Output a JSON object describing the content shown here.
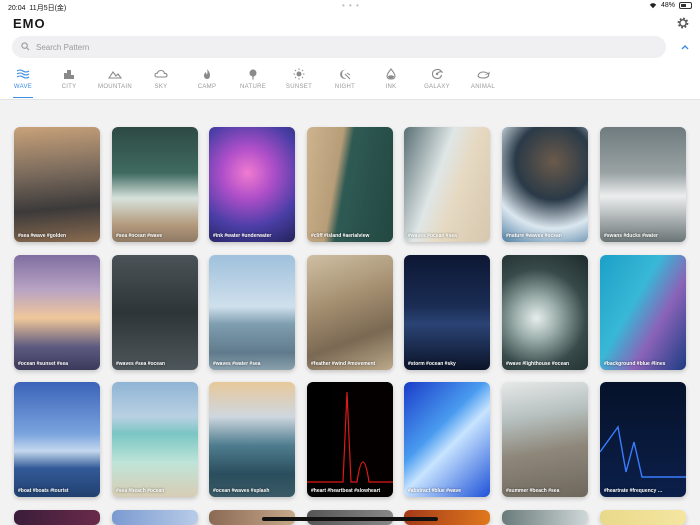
{
  "status": {
    "time": "20:04",
    "date": "11月5日(金)",
    "battery": "48%"
  },
  "app": {
    "title": "EMO"
  },
  "search": {
    "placeholder": "Search Pattern",
    "value": ""
  },
  "icons": {
    "settings": "gear-icon",
    "collapse": "chevron-up-icon",
    "search": "search-icon"
  },
  "colors": {
    "accent": "#3b8de6",
    "inactive": "#999999"
  },
  "categories": [
    {
      "label": "WAVE",
      "icon": "wave-icon",
      "active": true
    },
    {
      "label": "CITY",
      "icon": "city-icon"
    },
    {
      "label": "MOUNTAIN",
      "icon": "mountain-icon"
    },
    {
      "label": "SKY",
      "icon": "cloud-icon"
    },
    {
      "label": "CAMP",
      "icon": "fire-icon"
    },
    {
      "label": "NATURE",
      "icon": "tree-icon"
    },
    {
      "label": "SUNSET",
      "icon": "sun-icon"
    },
    {
      "label": "NIGHT",
      "icon": "moon-icon"
    },
    {
      "label": "INK",
      "icon": "ink-drop-icon"
    },
    {
      "label": "GALAXY",
      "icon": "galaxy-icon"
    },
    {
      "label": "ANIMAL",
      "icon": "animal-icon"
    }
  ],
  "patterns": [
    {
      "tags": "#sea #wave #golden",
      "bg": "linear-gradient(175deg,#c9a27a 0%,#7a6a5c 40%,#3c3a3a 70%,#8a6b4f 100%)"
    },
    {
      "tags": "#sea #ocean #wave",
      "bg": "linear-gradient(180deg,#2d4a43 0%,#3f6a60 40%,#d7e2dc 62%,#b49a7e 85%,#8e7a64 100%)"
    },
    {
      "tags": "#ink #water #underwater",
      "bg": "radial-gradient(circle at 45% 40%,#f07bd0 0%,#b04fc9 30%,#4a3ea6 65%,#23235a 100%)"
    },
    {
      "tags": "#cliff #island #aerialview",
      "bg": "linear-gradient(100deg,#cdb48f 0%,#b79d78 35%,#2f5a54 45%,#234741 100%)"
    },
    {
      "tags": "#waves #ocean #sea",
      "bg": "linear-gradient(110deg,#596f74 0%,#dfe6e6 40%,#e6d9c2 60%,#d6c7ad 100%)"
    },
    {
      "tags": "#nature #waves #ocean",
      "bg": "radial-gradient(circle at 60% 30%,#6b5a4a 0%,#2a3a48 40%,#dbe7ef 70%,#4f7ea3 100%)"
    },
    {
      "tags": "#swans #ducks #water",
      "bg": "linear-gradient(180deg,#6f7b7e 0%,#9aa3a4 40%,#eceeee 60%,#6a7476 100%)"
    },
    {
      "tags": "#ocean #sunset #sea",
      "bg": "linear-gradient(180deg,#7f6ea0 0%,#b8a3c4 30%,#f0c79a 55%,#5d5a80 80%,#3b3a5b 100%)"
    },
    {
      "tags": "#waves #sea #ocean",
      "bg": "linear-gradient(180deg,#4a5357 0%,#2e3538 50%,#4d565a 100%)"
    },
    {
      "tags": "#waves #water #sea",
      "bg": "linear-gradient(180deg,#9fc0dc 0%,#cfe0ec 45%,#7f9eb0 60%,#607b8c 85%,#8aa0ad 100%)"
    },
    {
      "tags": "#feather #wind #movement",
      "bg": "linear-gradient(160deg,#cfc0a3 0%,#a48e70 40%,#7a6953 70%,#bca98a 100%)"
    },
    {
      "tags": "#storm #ocean #sky",
      "bg": "linear-gradient(180deg,#0d1733 0%,#1b2d55 45%,#2b4475 60%,#0b1328 100%)"
    },
    {
      "tags": "#wave #lighthouse #ocean",
      "bg": "radial-gradient(circle at 40% 55%,#e6eeec 0%,#9fb1ad 25%,#384a4a 60%,#1d2a2c 100%)"
    },
    {
      "tags": "#background #blue #lines",
      "bg": "linear-gradient(120deg,#1ca0c8 0%,#38b8d6 40%,#8a63b8 65%,#1c3c82 100%)"
    },
    {
      "tags": "#boat #boats #tourist",
      "bg": "linear-gradient(180deg,#3b63b8 0%,#7aa4de 45%,#c4d8ee 60%,#335a98 75%,#20406f 100%)"
    },
    {
      "tags": "#sea #beach #ocean",
      "bg": "linear-gradient(180deg,#8fb4d4 0%,#b9d0e2 30%,#7ac6c4 45%,#bfe4d8 70%,#d8cdb4 100%)"
    },
    {
      "tags": "#ocean #waves #splash",
      "bg": "linear-gradient(180deg,#e7c89a 0%,#cfd7df 30%,#4f7d8f 55%,#2a4e5d 80%,#3a5a66 100%)"
    },
    {
      "tags": "#heart #heartbeat #slowheart",
      "bg": "linear-gradient(90deg,#000000 0%,#050000 100%)"
    },
    {
      "tags": "#abstract #blue #wave",
      "bg": "linear-gradient(135deg,#1a3cc8 0%,#4a9cf0 40%,#c8e4ff 55%,#1e52d8 100%)"
    },
    {
      "tags": "#summer #beach #sea",
      "bg": "linear-gradient(170deg,#e6e9e8 0%,#b7c1c0 30%,#8d8679 60%,#6e675c 100%)"
    },
    {
      "tags": "#heartrate #frequency …",
      "bg": "linear-gradient(180deg,#06122a 0%,#0b1f4a 100%)"
    }
  ]
}
